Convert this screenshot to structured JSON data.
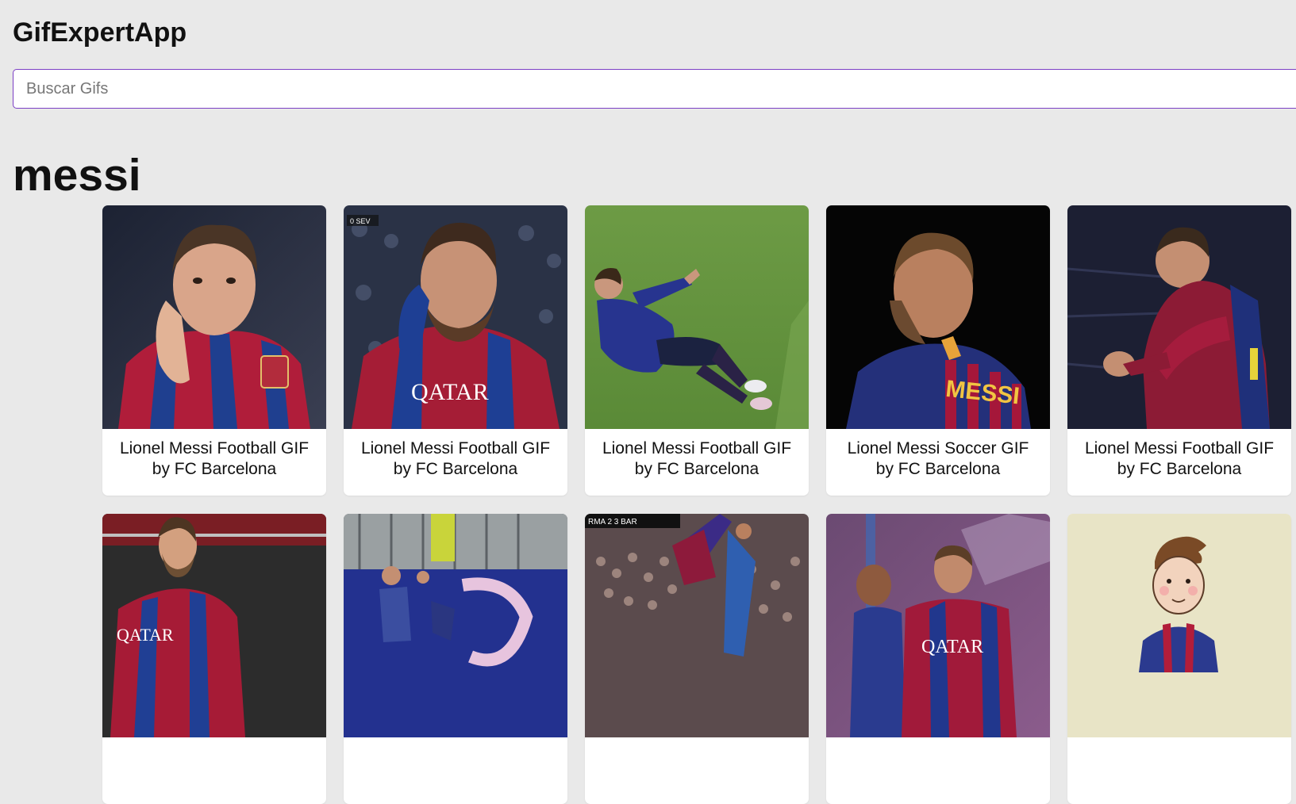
{
  "app": {
    "title": "GifExpertApp"
  },
  "search": {
    "placeholder": "Buscar Gifs",
    "value": ""
  },
  "category": {
    "title": "messi"
  },
  "gifs": [
    {
      "title": "Lionel Messi Football GIF by FC Barcelona"
    },
    {
      "title": "Lionel Messi Football GIF by FC Barcelona"
    },
    {
      "title": "Lionel Messi Football GIF by FC Barcelona"
    },
    {
      "title": "Lionel Messi Soccer GIF by FC Barcelona"
    },
    {
      "title": "Lionel Messi Football GIF by FC Barcelona"
    },
    {
      "title": ""
    },
    {
      "title": ""
    },
    {
      "title": ""
    },
    {
      "title": ""
    },
    {
      "title": ""
    }
  ],
  "overlays": {
    "score_badge": "0  SEV",
    "broadcast_score": "RMA 2 3 BAR",
    "jersey_text": "MESSI",
    "sponsor_text": "QATAR"
  }
}
